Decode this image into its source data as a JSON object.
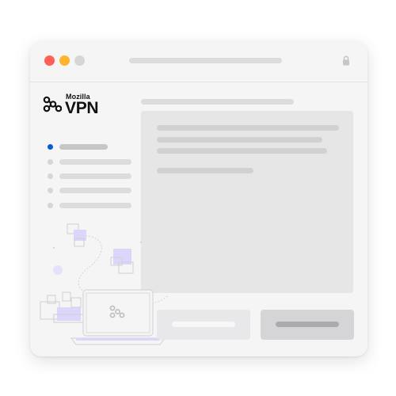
{
  "window": {
    "controls": [
      "close",
      "minimize",
      "maximize"
    ],
    "lock_icon": "lock-icon"
  },
  "logo": {
    "brand": "Mozilla",
    "product": "VPN",
    "icon": "vpn-logo-icon"
  },
  "sidebar": {
    "items": [
      {
        "active": true
      },
      {
        "active": false
      },
      {
        "active": false
      },
      {
        "active": false
      },
      {
        "active": false
      }
    ],
    "active_color": "#0a5bd6"
  },
  "colors": {
    "close": "#ff5f57",
    "minimize": "#fdb52c",
    "illustration_accent": "#ddd6fb",
    "window_bg": "#f5f5f6"
  },
  "illustration": {
    "icons": [
      "laptop-icon",
      "vpn-logo-icon",
      "puzzle-pieces-icon",
      "building-blocks-icon"
    ]
  }
}
